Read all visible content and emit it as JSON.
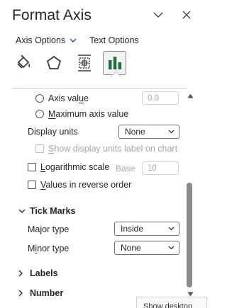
{
  "header": {
    "title": "Format Axis",
    "collapse_icon": "chevron-down-icon",
    "close_icon": "close-icon"
  },
  "option_tabs": [
    {
      "label": "Axis Options",
      "has_dropdown": true
    },
    {
      "label": "Text Options",
      "has_dropdown": false
    }
  ],
  "icon_tabs": [
    {
      "name": "fill-line-icon"
    },
    {
      "name": "effects-pentagon-icon"
    },
    {
      "name": "size-properties-icon"
    },
    {
      "name": "axis-options-bar-chart-icon",
      "active": true
    }
  ],
  "axis": {
    "axis_value": {
      "label_pre": "Axis val",
      "label_u": "u",
      "label_post": "e",
      "value": "0.0"
    },
    "max_axis_value": {
      "label_u": "M",
      "label_post": "aximum axis value"
    },
    "display_units": {
      "label": "Display units",
      "value": "None"
    },
    "show_units_label": {
      "label_u": "S",
      "label_post": "how display units label on chart"
    },
    "log_scale": {
      "label_u": "L",
      "label_post": "ogarithmic scale",
      "base_label": "Base",
      "base_value": "10"
    },
    "reverse_order": {
      "label_u": "V",
      "label_post": "alues in reverse order"
    }
  },
  "tick_marks": {
    "title": "Tick Marks",
    "major": {
      "label_pre": "Major type",
      "value": "Inside"
    },
    "minor": {
      "label_pre": "M",
      "label_u": "i",
      "label_post": "nor type",
      "value": "None"
    }
  },
  "sections": {
    "labels": "Labels",
    "number": "Number"
  },
  "tooltip": "Show desktop",
  "colors": {
    "accent": "#2b579a",
    "icon_dark": "#3b3b3b",
    "active_icon_green": "#1f6f3a"
  }
}
